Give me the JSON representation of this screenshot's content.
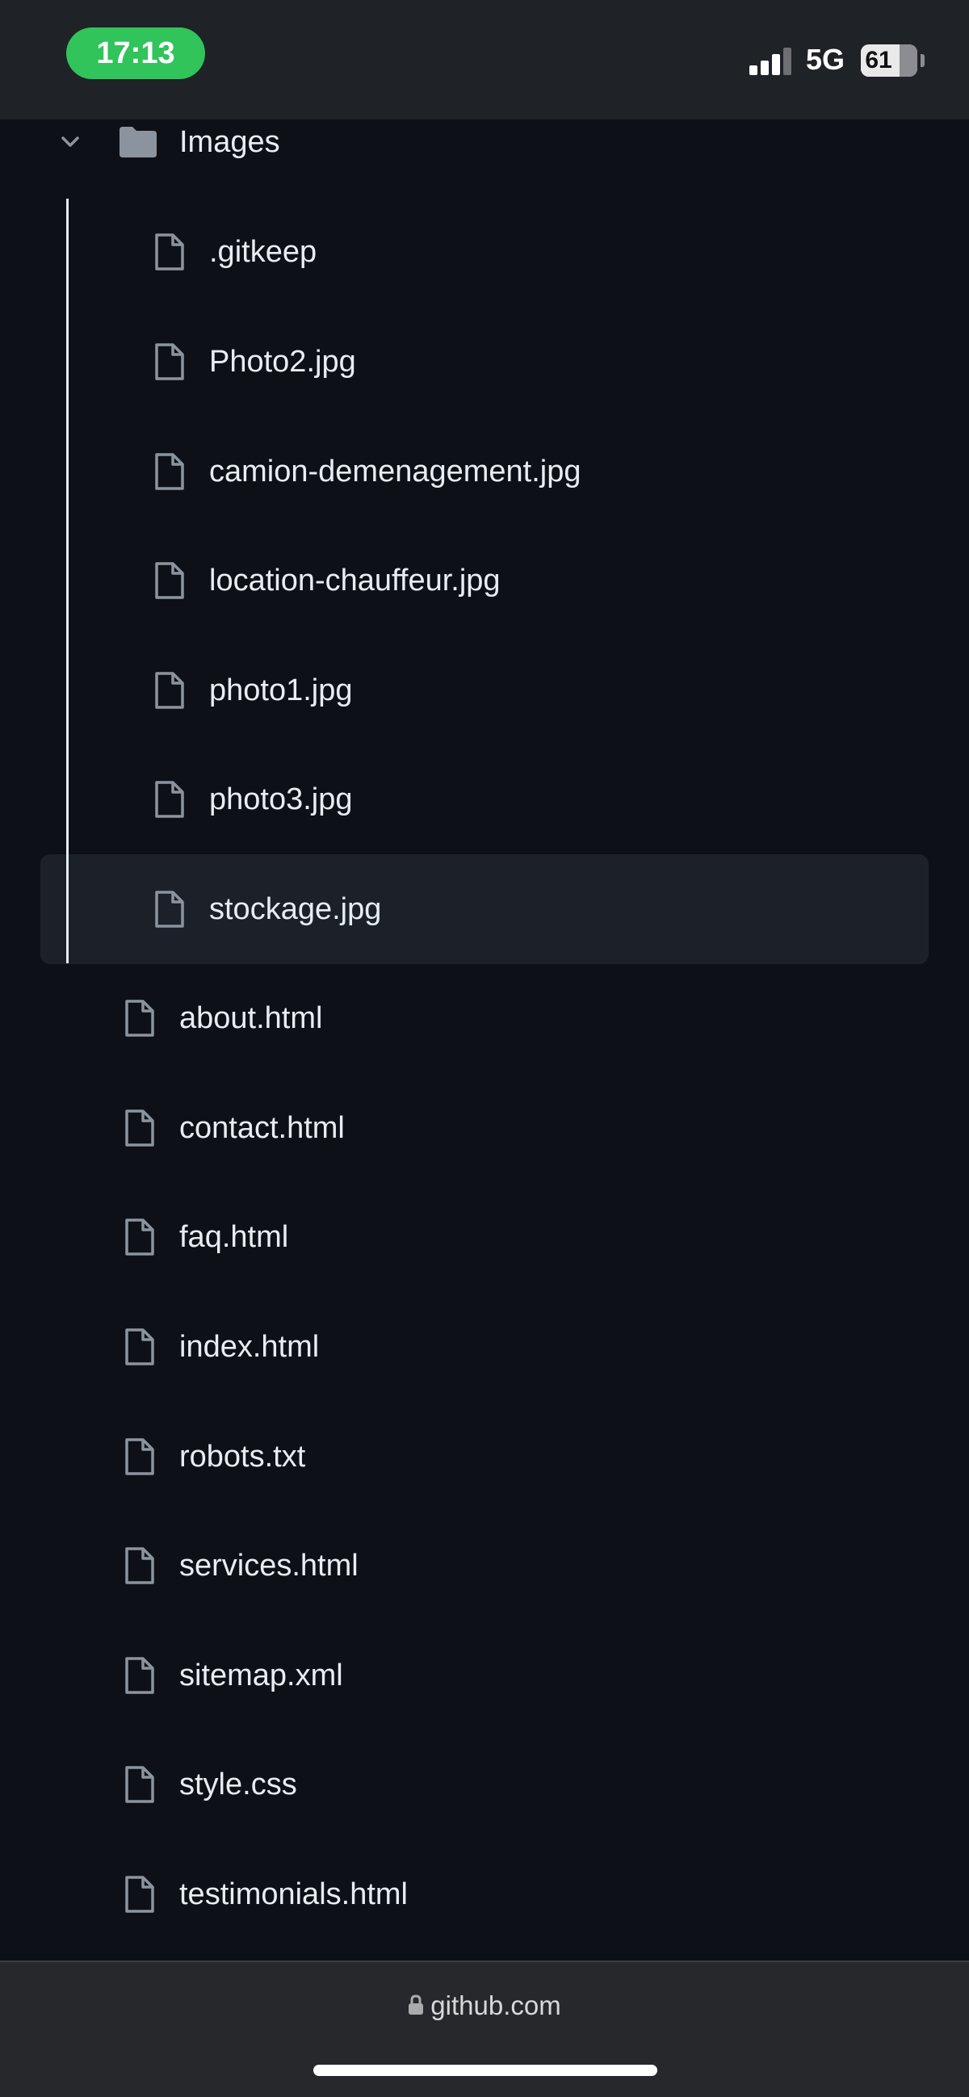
{
  "status_bar": {
    "time": "17:13",
    "network": "5G",
    "battery": "61"
  },
  "tree": {
    "folder": {
      "name": "Images",
      "icon": "folder-icon",
      "expanded": true,
      "children": [
        ".gitkeep",
        "Photo2.jpg",
        "camion-demenagement.jpg",
        "location-chauffeur.jpg",
        "photo1.jpg",
        "photo3.jpg",
        "stockage.jpg"
      ],
      "selected_child": "stockage.jpg"
    },
    "root_files": [
      "about.html",
      "contact.html",
      "faq.html",
      "index.html",
      "robots.txt",
      "services.html",
      "sitemap.xml",
      "style.css",
      "testimonials.html"
    ]
  },
  "browser": {
    "url": "github.com"
  },
  "colors": {
    "background": "#0d1117",
    "text": "#e6edf3",
    "icon": "#8b949e",
    "selected": "#1c2129",
    "status_green": "#30c45a"
  }
}
